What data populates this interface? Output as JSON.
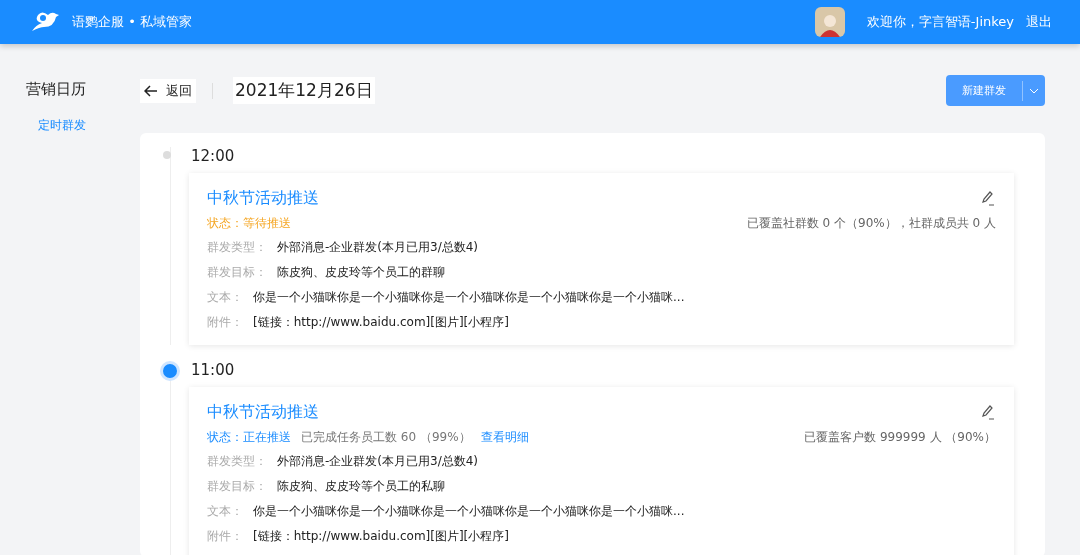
{
  "header": {
    "brand": "语鹦企服 • 私域管家",
    "greeting": "欢迎你，字言智语-Jinkey",
    "logout": "退出"
  },
  "sidebar": {
    "title": "营销日历",
    "items": [
      {
        "label": "定时群发",
        "selected": true
      }
    ]
  },
  "toolbar": {
    "back": "返回",
    "date": "2021年12月26日",
    "new_button": "新建群发"
  },
  "timeline": [
    {
      "time": "12:00",
      "selected": false,
      "title": "中秋节活动推送",
      "status": {
        "kind": "pending",
        "text": "状态：等待推送"
      },
      "coverage": "已覆盖社群数 0 个（90%），社群成员共 0 人",
      "fields": [
        {
          "label": "群发类型：",
          "value": "外部消息-企业群发(本月已用3/总数4)"
        },
        {
          "label": "群发目标：",
          "value": "陈皮狗、皮皮玲等个员工的群聊"
        },
        {
          "label": "文本：",
          "value": "你是一个小猫咪你是一个小猫咪你是一个小猫咪你是一个小猫咪你是一个小猫咪..."
        },
        {
          "label": "附件：",
          "value": "[链接：http://www.baidu.com][图片][小程序]"
        }
      ]
    },
    {
      "time": "11:00",
      "selected": true,
      "title": "中秋节活动推送",
      "status": {
        "kind": "sending",
        "text": "状态：正在推送",
        "progress": "已完成任务员工数 60 （99%）",
        "link": "查看明细"
      },
      "coverage": "已覆盖客户数 999999 人 （90%）",
      "fields": [
        {
          "label": "群发类型：",
          "value": "外部消息-企业群发(本月已用3/总数4)"
        },
        {
          "label": "群发目标：",
          "value": "陈皮狗、皮皮玲等个员工的私聊"
        },
        {
          "label": "文本：",
          "value": "你是一个小猫咪你是一个小猫咪你是一个小猫咪你是一个小猫咪你是一个小猫咪..."
        },
        {
          "label": "附件：",
          "value": "[链接：http://www.baidu.com][图片][小程序]"
        }
      ]
    }
  ]
}
